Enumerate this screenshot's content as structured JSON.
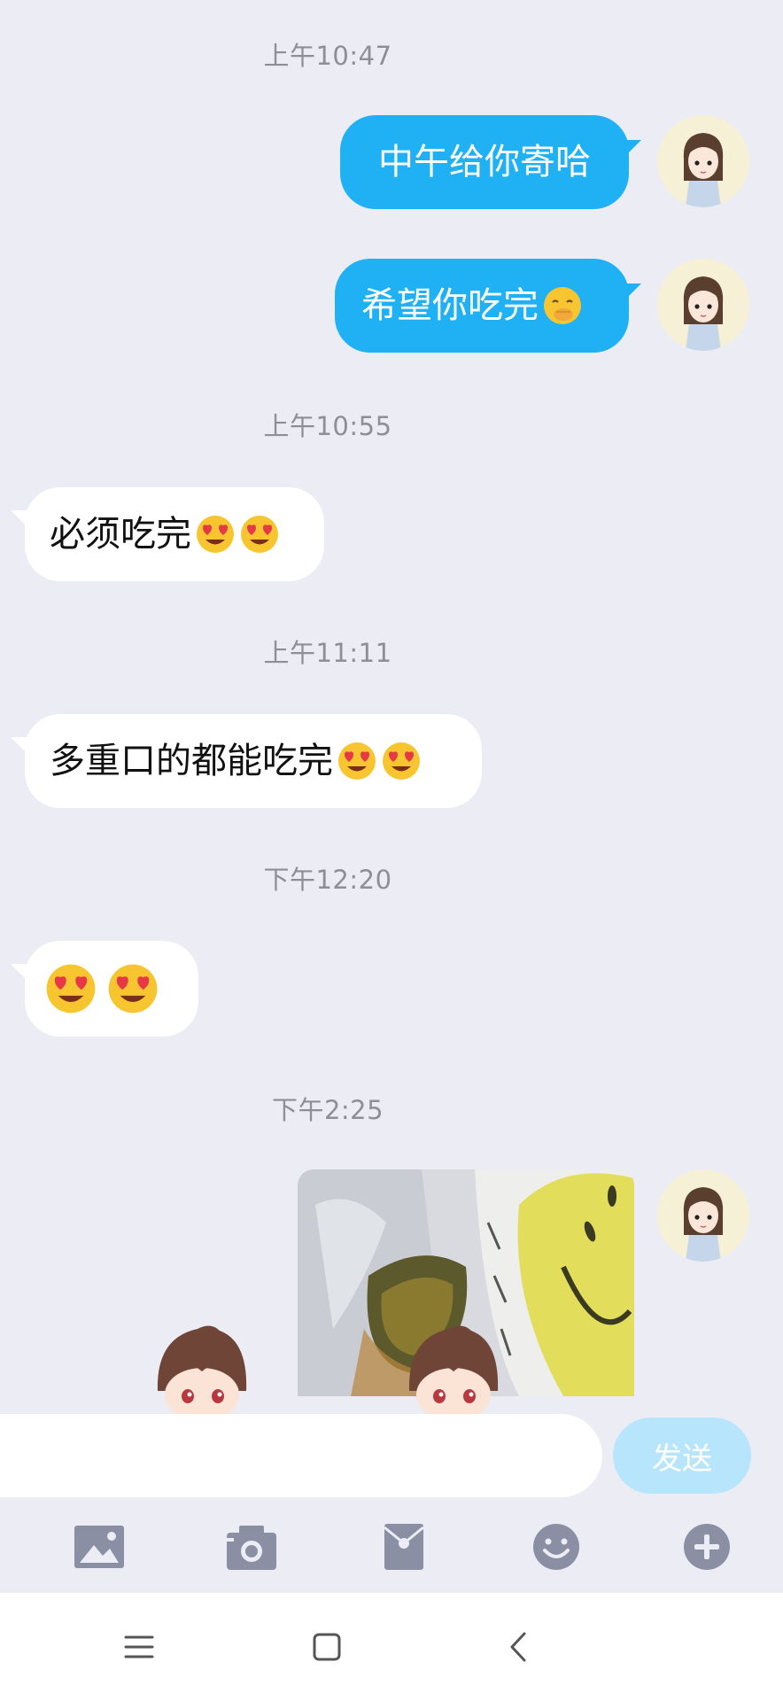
{
  "messages": [
    {
      "time": "上午10:47"
    },
    {
      "out1": "中午给你寄哈"
    },
    {
      "out2": "希望你吃完"
    },
    {
      "time": "上午10:55"
    },
    {
      "in1": "必须吃完"
    },
    {
      "time": "上午11:11"
    },
    {
      "in2": "多重口的都能吃完"
    },
    {
      "time": "下午12:20"
    },
    {
      "time": "下午2:25"
    }
  ],
  "times": [
    "上午10:47",
    "上午10:55",
    "上午11:11",
    "下午12:20",
    "下午2:25"
  ],
  "bubbles": {
    "out1": "中午给你寄哈",
    "out2": "希望你吃完",
    "in1": "必须吃完",
    "in2": "多重口的都能吃完"
  },
  "input": {
    "value": "",
    "send_label": "发送"
  },
  "toolbar": {
    "icons": [
      "image-icon",
      "camera-icon",
      "red-packet-icon",
      "emoji-icon",
      "plus-icon"
    ]
  },
  "navbar": {
    "icons": [
      "menu-icon",
      "home-icon",
      "back-icon"
    ]
  },
  "colors": {
    "out_bubble": "#1fb1f4",
    "background": "#ececf5",
    "send_disabled": "#b7e5fb",
    "tool_icon": "#8a8fa3"
  }
}
